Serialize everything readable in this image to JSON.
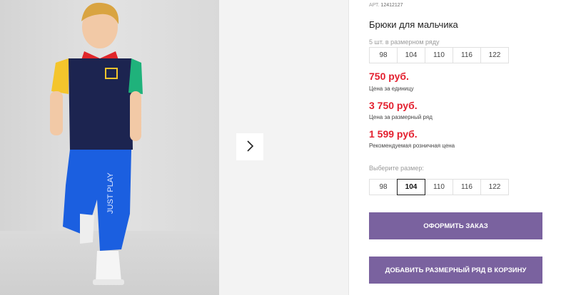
{
  "product": {
    "art_label": "АРТ.",
    "art_number": "12412127",
    "title": "Брюки для мальчика"
  },
  "size_range": {
    "caption": "5 шт. в размерном ряду",
    "sizes": [
      "98",
      "104",
      "110",
      "116",
      "122"
    ]
  },
  "prices": {
    "unit_price": "750 руб.",
    "unit_caption": "Цена за единицу",
    "range_price": "3 750 руб.",
    "range_caption": "Цена за размерный ряд",
    "retail_price": "1 599 руб.",
    "retail_caption": "Рекомендуемая розничная цена"
  },
  "size_select": {
    "caption": "Выберите размер:",
    "sizes": [
      "98",
      "104",
      "110",
      "116",
      "122"
    ],
    "selected": "104"
  },
  "actions": {
    "order_label": "ОФОРМИТЬ ЗАКАЗ",
    "add_range_label": "ДОБАВИТЬ РАЗМЕРНЫЙ РЯД В КОРЗИНУ"
  },
  "colors": {
    "price": "#e3202f",
    "button": "#7a629f"
  },
  "icons": {
    "next": "chevron-right-icon"
  }
}
